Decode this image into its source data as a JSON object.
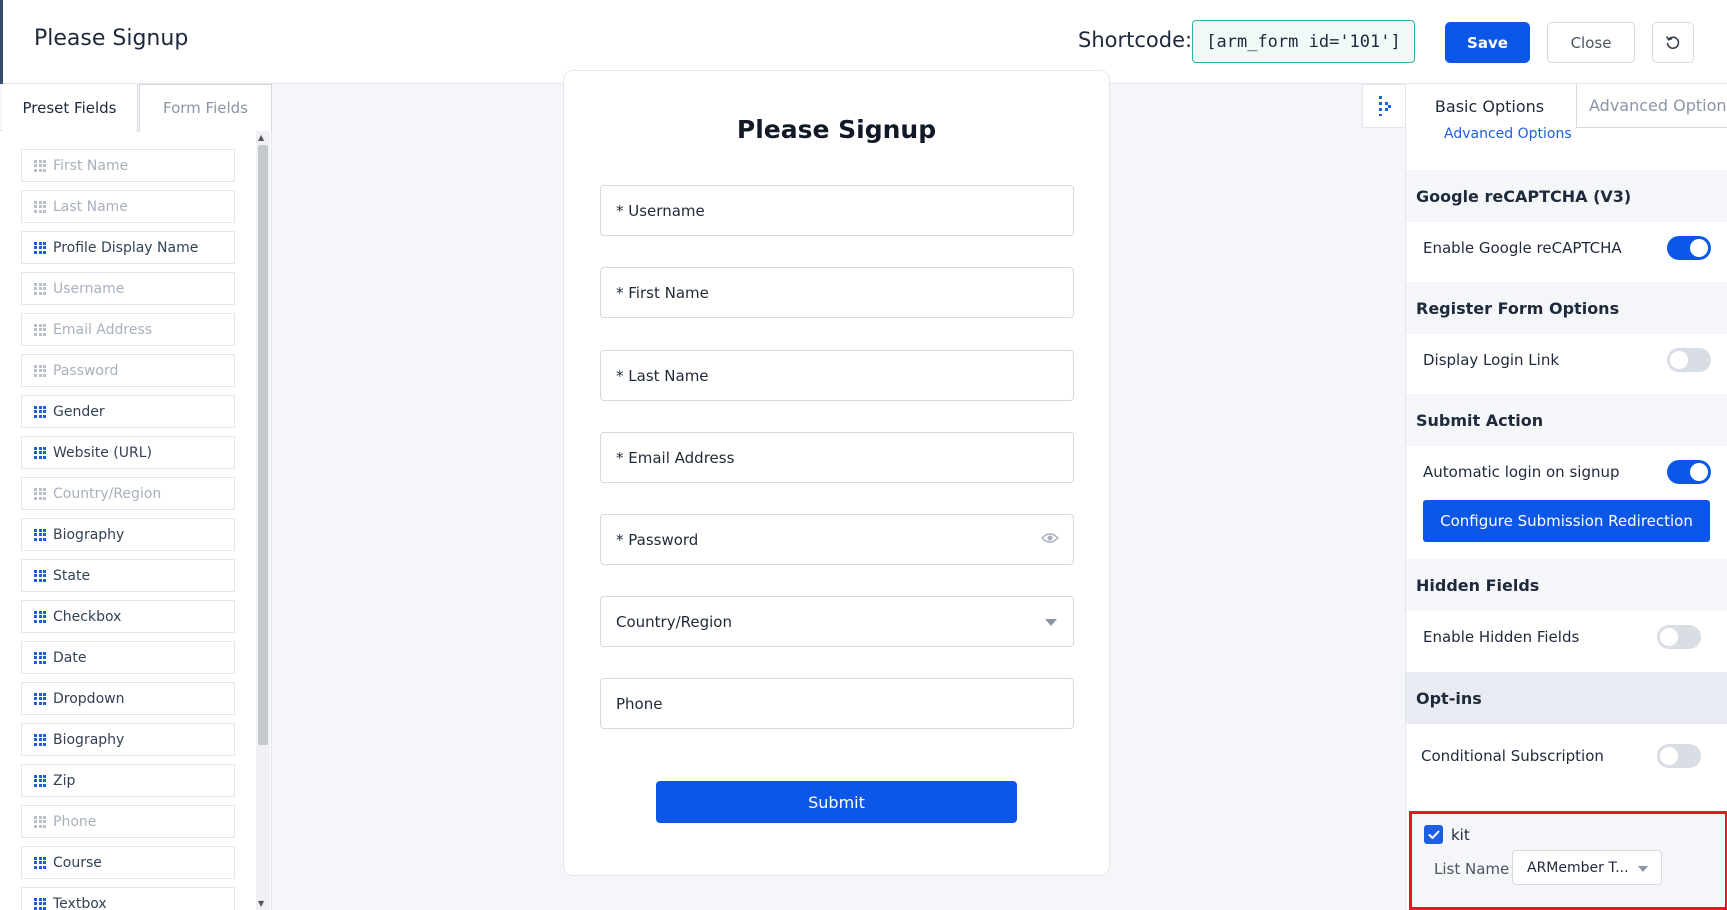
{
  "header": {
    "title": "Please Signup",
    "shortcode_label": "Shortcode:",
    "shortcode_value": "[arm_form id='101']",
    "save_label": "Save",
    "close_label": "Close"
  },
  "left_panel": {
    "tabs": [
      "Preset Fields",
      "Form Fields"
    ],
    "fields": [
      {
        "label": "First Name",
        "enabled": false
      },
      {
        "label": "Last Name",
        "enabled": false
      },
      {
        "label": "Profile Display Name",
        "enabled": true
      },
      {
        "label": "Username",
        "enabled": false
      },
      {
        "label": "Email Address",
        "enabled": false
      },
      {
        "label": "Password",
        "enabled": false
      },
      {
        "label": "Gender",
        "enabled": true
      },
      {
        "label": "Website (URL)",
        "enabled": true
      },
      {
        "label": "Country/Region",
        "enabled": false
      },
      {
        "label": "Biography",
        "enabled": true
      },
      {
        "label": "State",
        "enabled": true
      },
      {
        "label": "Checkbox",
        "enabled": true
      },
      {
        "label": "Date",
        "enabled": true
      },
      {
        "label": "Dropdown",
        "enabled": true
      },
      {
        "label": "Biography",
        "enabled": true
      },
      {
        "label": "Zip",
        "enabled": true
      },
      {
        "label": "Phone",
        "enabled": false
      },
      {
        "label": "Course",
        "enabled": true
      },
      {
        "label": "Textbox",
        "enabled": true
      }
    ]
  },
  "form": {
    "title": "Please Signup",
    "fields": [
      "* Username",
      "* First Name",
      "* Last Name",
      "* Email Address",
      "* Password",
      "Country/Region",
      "Phone"
    ],
    "submit_label": "Submit"
  },
  "right_panel": {
    "tab_basic": "Basic Options",
    "tab_advanced": "Advanced Options",
    "advanced_link": "Advanced Options",
    "recaptcha": {
      "heading": "Google reCAPTCHA (V3)",
      "label": "Enable Google reCAPTCHA",
      "on": true
    },
    "register": {
      "heading": "Register Form Options",
      "label": "Display Login Link",
      "on": false
    },
    "submit_action": {
      "heading": "Submit Action",
      "label": "Automatic login on signup",
      "on": true,
      "button": "Configure Submission Redirection"
    },
    "hidden": {
      "heading": "Hidden Fields",
      "label": "Enable Hidden Fields",
      "on": false
    },
    "optins": {
      "heading": "Opt-ins",
      "label": "Conditional Subscription",
      "on": false,
      "kit_label": "kit",
      "kit_checked": true,
      "list_label": "List Name",
      "list_value": "ARMember T..."
    }
  },
  "colors": {
    "accent": "#0d57e8",
    "highlight": "#e01b24",
    "shortcode_border": "#2bb5a0"
  }
}
